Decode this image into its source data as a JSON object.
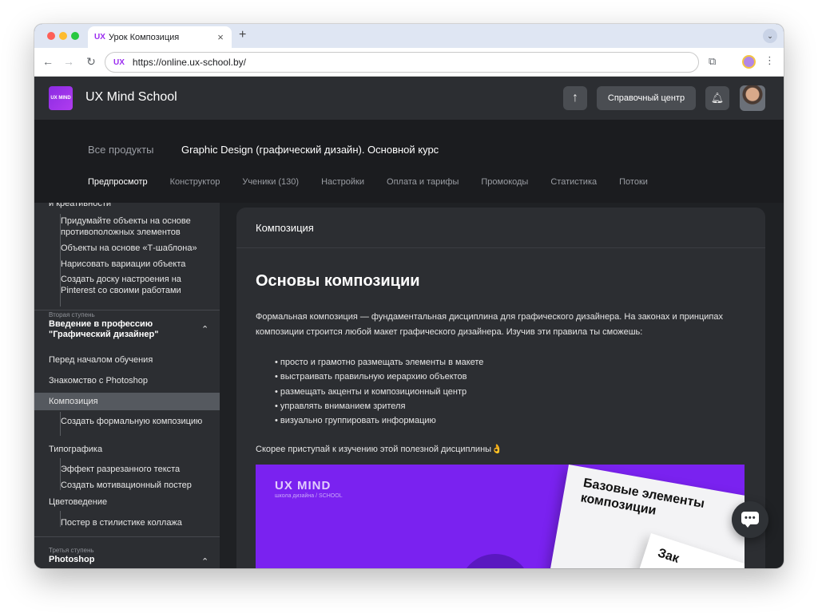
{
  "browser": {
    "tab_favicon": "UX",
    "tab_title": "Урок Композиция",
    "tab_close": "×",
    "new_tab": "+",
    "tab_menu": "⌄",
    "url_favicon": "UX",
    "url": "https://online.ux-school.by/",
    "back": "←",
    "forward": "→",
    "reload": "↻",
    "extensions": "⧉",
    "menu": "⋮"
  },
  "header": {
    "logo_text": "UX MIND",
    "brand": "UX Mind School",
    "up_icon": "↑",
    "help_center": "Справочный центр",
    "bell_icon": "🔔︎"
  },
  "productbar": {
    "all_products": "Все продукты",
    "course_title": "Graphic Design (графический дизайн). Основной курс",
    "tabs": [
      {
        "label": "Предпросмотр",
        "active": true
      },
      {
        "label": "Конструктор"
      },
      {
        "label": "Ученики (130)"
      },
      {
        "label": "Настройки"
      },
      {
        "label": "Оплата и тарифы"
      },
      {
        "label": "Промокоды"
      },
      {
        "label": "Статистика"
      },
      {
        "label": "Потоки"
      }
    ]
  },
  "sidebar": {
    "cut_top": "и креативности",
    "lessons_top": [
      "Придумайте объекты на основе противоположных элементов",
      "Объекты на основе «Т-шаблона»",
      "Нарисовать вариации объекта",
      "Создать доску настроения на Pinterest со своими работами"
    ],
    "stage2_label": "Вторая ступень",
    "stage2_title": "Введение в профессию \"Графический дизайнер\"",
    "chevron": "⌃",
    "items": [
      "Перед началом обучения",
      "Знакомство с Photoshop",
      "Композиция",
      "Создать формальную композицию",
      "Типографика",
      "Эффект разрезанного текста",
      "Создать мотивационный постер",
      "Цветоведение",
      "Постер в стилистике коллажа"
    ],
    "stage3_label": "Третья ступень",
    "stage3_title": "Photoshop"
  },
  "content": {
    "header": "Композиция",
    "title": "Основы композиции",
    "paragraph": "Формальная композиция — фундаментальная дисциплина для графического дизайнера. На законах и принципах композиции строится любой макет графического дизайнера. Изучив эти правила ты сможешь:",
    "bullets": [
      "• просто и грамотно размещать элементы в макете",
      "• выстраивать правильную иерархию объектов",
      "• размещать акценты и композиционный центр",
      "• управлять вниманием зрителя",
      "• визуально группировать информацию"
    ],
    "cta": "Скорее приступай к изучению этой полезной дисциплины👌",
    "banner": {
      "logo": "UX MIND",
      "logo_sub": "школа дизайна / SCHOOL",
      "card_title": "Базовые элементы композиции",
      "card2_text": "Зак"
    }
  },
  "chat": {
    "dots": "•••"
  },
  "colors": {
    "accent": "#7a22f0",
    "sidebar_active": "#55595f",
    "bg_dark": "#1b1c1f"
  }
}
